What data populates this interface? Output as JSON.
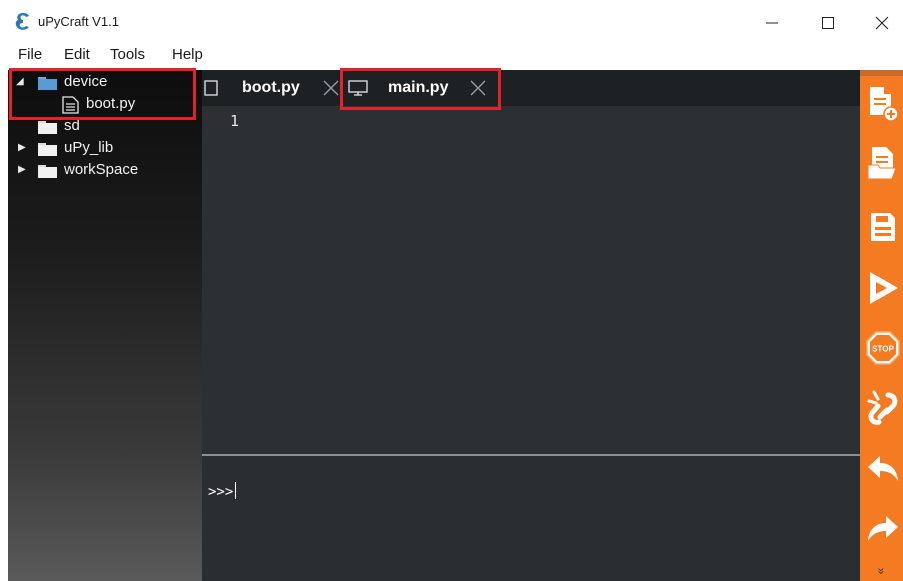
{
  "window": {
    "title": "uPyCraft V1.1",
    "controls": {
      "minimize": "—",
      "maximize": "☐",
      "close": "✕"
    }
  },
  "menu": [
    "File",
    "Edit",
    "Tools",
    "Help"
  ],
  "tree": [
    {
      "label": "device",
      "expanded": true,
      "icon": "folder-icon"
    },
    {
      "label": "boot.py",
      "icon": "file-icon"
    },
    {
      "label": "sd",
      "icon": "folder-icon"
    },
    {
      "label": "uPy_lib",
      "expanded": false,
      "icon": "folder-icon"
    },
    {
      "label": "workSpace",
      "expanded": false,
      "icon": "folder-icon"
    }
  ],
  "tabs": [
    {
      "label": "boot.py",
      "icon": "document-icon"
    },
    {
      "label": "main.py",
      "icon": "monitor-icon",
      "active": true
    }
  ],
  "editor": {
    "line_numbers": [
      "1"
    ]
  },
  "shell": {
    "prompt": ">>>"
  },
  "toolbar": [
    "new-file-icon",
    "open-file-icon",
    "save-icon",
    "run-icon",
    "stop-icon",
    "connect-icon",
    "undo-icon",
    "redo-icon",
    "more-icon"
  ],
  "toolbar_text": {
    "stop": "STOP",
    "more": "»"
  },
  "colors": {
    "toolbar": "#f57b23",
    "highlight": "#e3222a",
    "editor_bg": "#2c3034"
  }
}
